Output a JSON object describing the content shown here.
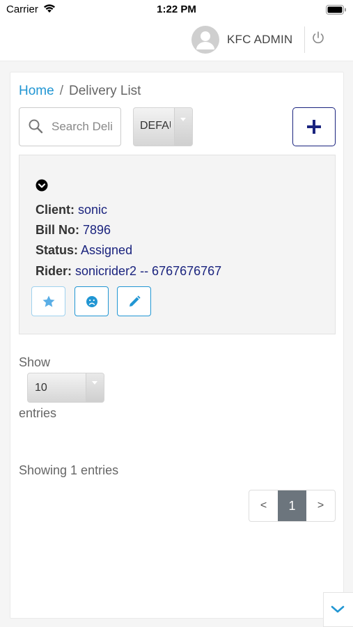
{
  "status_bar": {
    "carrier": "Carrier",
    "time": "1:22 PM",
    "icons": [
      "wifi-icon",
      "battery-icon"
    ]
  },
  "header": {
    "user_name": "KFC ADMIN",
    "icons": [
      "avatar-icon",
      "power-icon"
    ]
  },
  "breadcrumb": {
    "home": "Home",
    "separator": "/",
    "current": "Delivery List"
  },
  "toolbar": {
    "search_placeholder": "Search Deli",
    "filter_value": "DEFAULT",
    "add_icon": "plus-icon"
  },
  "delivery": {
    "client_label": "Client:",
    "client": "sonic",
    "bill_label": "Bill No:",
    "bill_no": "7896",
    "status_label": "Status:",
    "status": "Assigned",
    "rider_label": "Rider:",
    "rider": "sonicrider2 -- 6767676767",
    "action_icons": [
      "star-icon",
      "sad-face-icon",
      "pencil-icon"
    ]
  },
  "table_controls": {
    "show_label": "Show",
    "page_length": "10",
    "entries_label": "entries",
    "info": "Showing 1 entries",
    "prev": "<",
    "current_page": "1",
    "next": ">"
  },
  "colors": {
    "accent": "#2196d3",
    "navy": "#1a237e",
    "active_page": "#6c757d"
  }
}
